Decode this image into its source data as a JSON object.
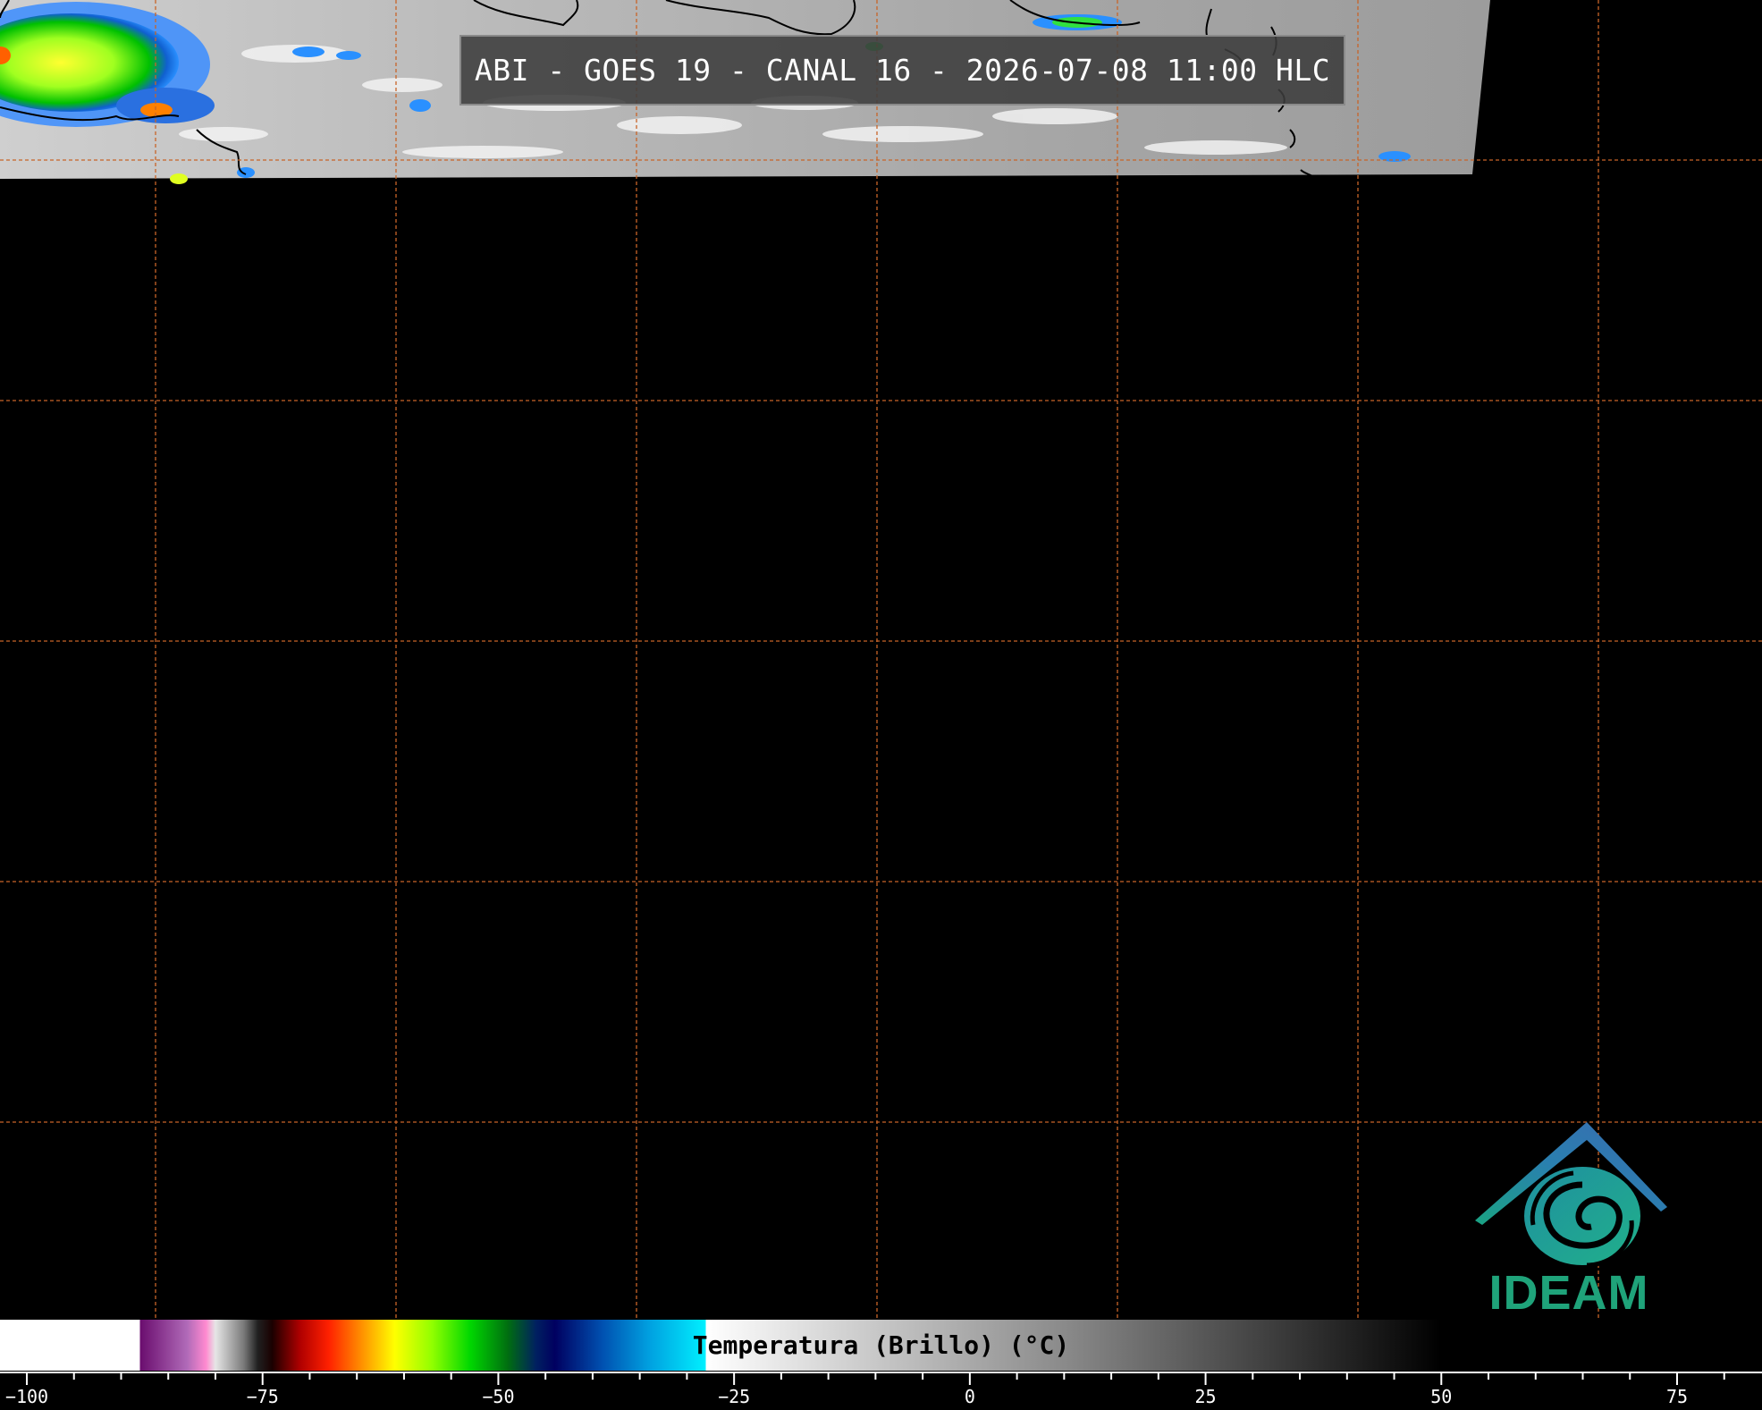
{
  "title": "ABI - GOES 19 - CANAL 16 - 2026-07-08 11:00 HLC",
  "logo": {
    "text": "IDEAM",
    "icon": "ideam-logo-icon",
    "color": "#1fa37a"
  },
  "colorbar": {
    "label": "Temperatura (Brillo) (°C)",
    "ticks": [
      "-100",
      "-75",
      "-50",
      "-25",
      "0",
      "25",
      "50",
      "75"
    ],
    "tick_values": [
      -100,
      -75,
      -50,
      -25,
      0,
      25,
      50,
      75
    ],
    "range": [
      -102,
      82
    ],
    "gradient_stops": [
      {
        "value": -102,
        "color": "#ffffff"
      },
      {
        "value": -88,
        "color": "#ffffff"
      },
      {
        "value": -88,
        "color": "#6a0d6e"
      },
      {
        "value": -83,
        "color": "#b06ab8"
      },
      {
        "value": -81,
        "color": "#ff8ad0"
      },
      {
        "value": -80,
        "color": "#e6e6e6"
      },
      {
        "value": -77,
        "color": "#7a7a7a"
      },
      {
        "value": -75.5,
        "color": "#202020"
      },
      {
        "value": -74,
        "color": "#1a0000"
      },
      {
        "value": -71,
        "color": "#b00000"
      },
      {
        "value": -68,
        "color": "#ff2000"
      },
      {
        "value": -65,
        "color": "#ff8000"
      },
      {
        "value": -61,
        "color": "#ffff00"
      },
      {
        "value": -57,
        "color": "#90ff00"
      },
      {
        "value": -53,
        "color": "#00d800"
      },
      {
        "value": -49,
        "color": "#006e10"
      },
      {
        "value": -46,
        "color": "#002060"
      },
      {
        "value": -44,
        "color": "#000060"
      },
      {
        "value": -39,
        "color": "#0050b0"
      },
      {
        "value": -34,
        "color": "#00a0e0"
      },
      {
        "value": -28,
        "color": "#00f0ff"
      },
      {
        "value": -28,
        "color": "#ffffff"
      },
      {
        "value": 10,
        "color": "#8a8a8a"
      },
      {
        "value": 50,
        "color": "#000000"
      },
      {
        "value": 82,
        "color": "#000000"
      }
    ]
  },
  "map": {
    "grid_color": "#c86428",
    "cloud_colors": [
      "#c8c8c8",
      "#ffffff",
      "#22a0ff",
      "#00e000",
      "#ffff00",
      "#ff4000"
    ]
  }
}
